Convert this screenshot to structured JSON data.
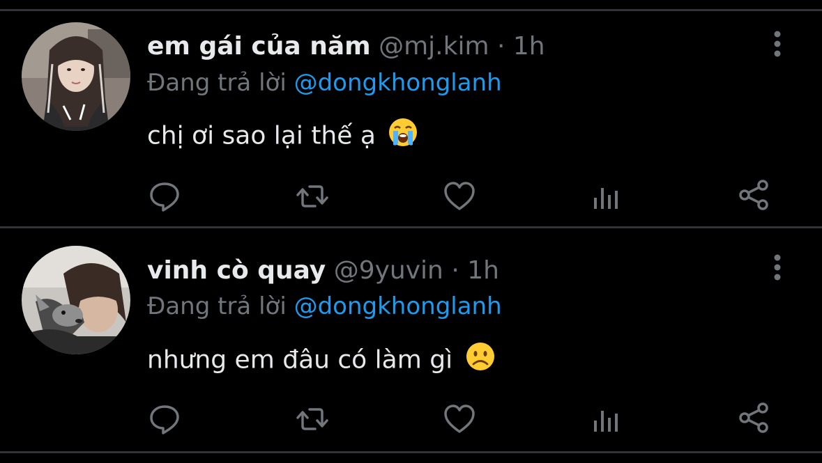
{
  "tweets": [
    {
      "display_name": "em gái của năm",
      "handle": "@mj.kim",
      "separator": "·",
      "time": "1h",
      "reply_prefix": "Đang trả lời",
      "reply_to": "@dongkhonglanh",
      "text": "chị ơi sao lại thế ạ",
      "emoji": "loudly-crying-face-emoji",
      "actions": [
        "reply-icon",
        "retweet-icon",
        "like-icon",
        "views-icon",
        "share-icon"
      ]
    },
    {
      "display_name": "vinh cò quay",
      "handle": "@9yuvin",
      "separator": "·",
      "time": "1h",
      "reply_prefix": "Đang trả lời",
      "reply_to": "@dongkhonglanh",
      "text": "nhưng em đâu có làm gì",
      "emoji": "frowning-face-emoji",
      "actions": [
        "reply-icon",
        "retweet-icon",
        "like-icon",
        "views-icon",
        "share-icon"
      ]
    }
  ],
  "colors": {
    "background": "#000000",
    "text": "#e7e9ea",
    "secondary": "#71767b",
    "mention": "#1d9bf0",
    "divider": "#2f3336"
  }
}
